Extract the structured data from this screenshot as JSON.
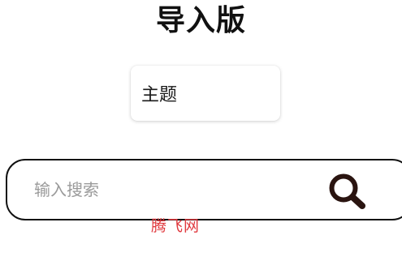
{
  "header": {
    "title": "导入版"
  },
  "theme_card": {
    "label": "主题"
  },
  "search": {
    "placeholder": "输入搜索",
    "value": "",
    "button_icon": "search-icon"
  },
  "watermark": {
    "text": "腾飞网"
  },
  "colors": {
    "title": "#111111",
    "placeholder": "#9a9a9a",
    "border": "#111111",
    "watermark": "#e0393e",
    "icon": "#2a1410"
  }
}
